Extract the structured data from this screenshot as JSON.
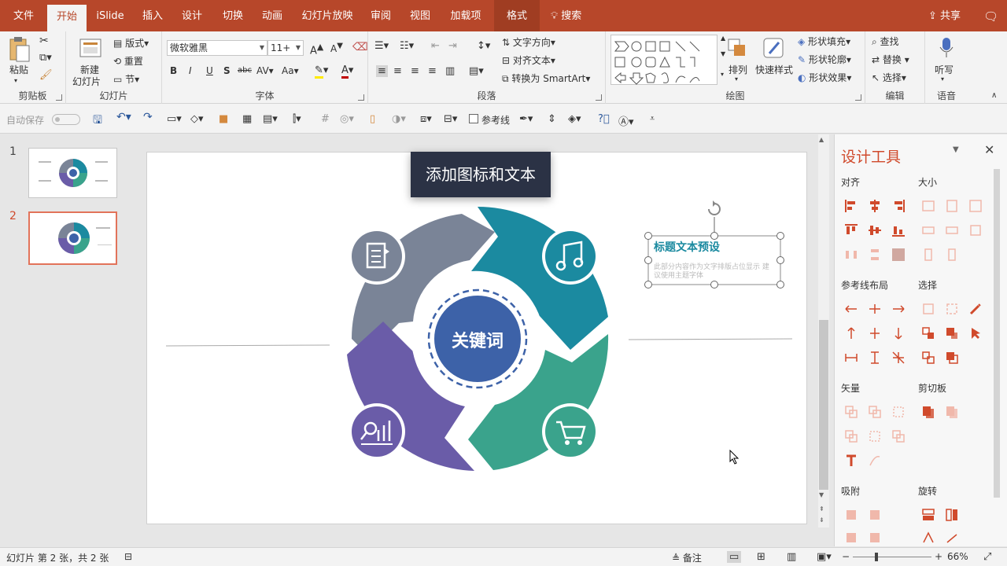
{
  "tabs": {
    "file": "文件",
    "home": "开始",
    "islide": "iSlide",
    "insert": "插入",
    "design": "设计",
    "transitions": "切换",
    "animations": "动画",
    "slideshow": "幻灯片放映",
    "review": "审阅",
    "view": "视图",
    "addins": "加载项",
    "format": "格式",
    "search": "搜索",
    "share": "共享"
  },
  "ribbon": {
    "clipboard": {
      "label": "剪贴板",
      "paste": "粘贴"
    },
    "slides": {
      "label": "幻灯片",
      "new_slide_1": "新建",
      "new_slide_2": "幻灯片",
      "layout": "版式",
      "reset": "重置",
      "section": "节"
    },
    "font": {
      "label": "字体",
      "font_name": "微软雅黑",
      "font_size": "11+"
    },
    "paragraph": {
      "label": "段落",
      "text_direction": "文字方向",
      "align_text": "对齐文本",
      "convert_smartart": "转换为 SmartArt"
    },
    "drawing": {
      "label": "绘图",
      "arrange": "排列",
      "quick_styles": "快速样式",
      "shape_fill": "形状填充",
      "shape_outline": "形状轮廓",
      "shape_effects": "形状效果"
    },
    "editing": {
      "label": "编辑",
      "find": "查找",
      "replace": "替换",
      "select": "选择"
    },
    "voice": {
      "label": "语音",
      "dictate": "听写"
    }
  },
  "qat": {
    "autosave": "自动保存",
    "guides": "参考线"
  },
  "thumbnails": [
    {
      "num": "1"
    },
    {
      "num": "2"
    }
  ],
  "slide": {
    "keyword": "关键词",
    "title_preset": "标题文本预设",
    "body_preset": "此部分内容作为文字排版占位显示 建议使用主题字体"
  },
  "tooltip": "添加图标和文本",
  "pane": {
    "title": "设计工具",
    "align": "对齐",
    "size": "大小",
    "guide_layout": "参考线布局",
    "select": "选择",
    "vector": "矢量",
    "clipboard": "剪切板",
    "snap": "吸附",
    "rotate": "旋转"
  },
  "status": {
    "slide_info": "幻灯片 第 2 张，共 2 张",
    "notes": "备注",
    "zoom": "66%"
  },
  "colors": {
    "accent": "#b7472a",
    "gray_arrow": "#7a8497",
    "teal_arrow": "#1b8aa0",
    "green_arrow": "#3aa38c",
    "purple_arrow": "#6a5ca8",
    "center": "#3d62a8"
  }
}
